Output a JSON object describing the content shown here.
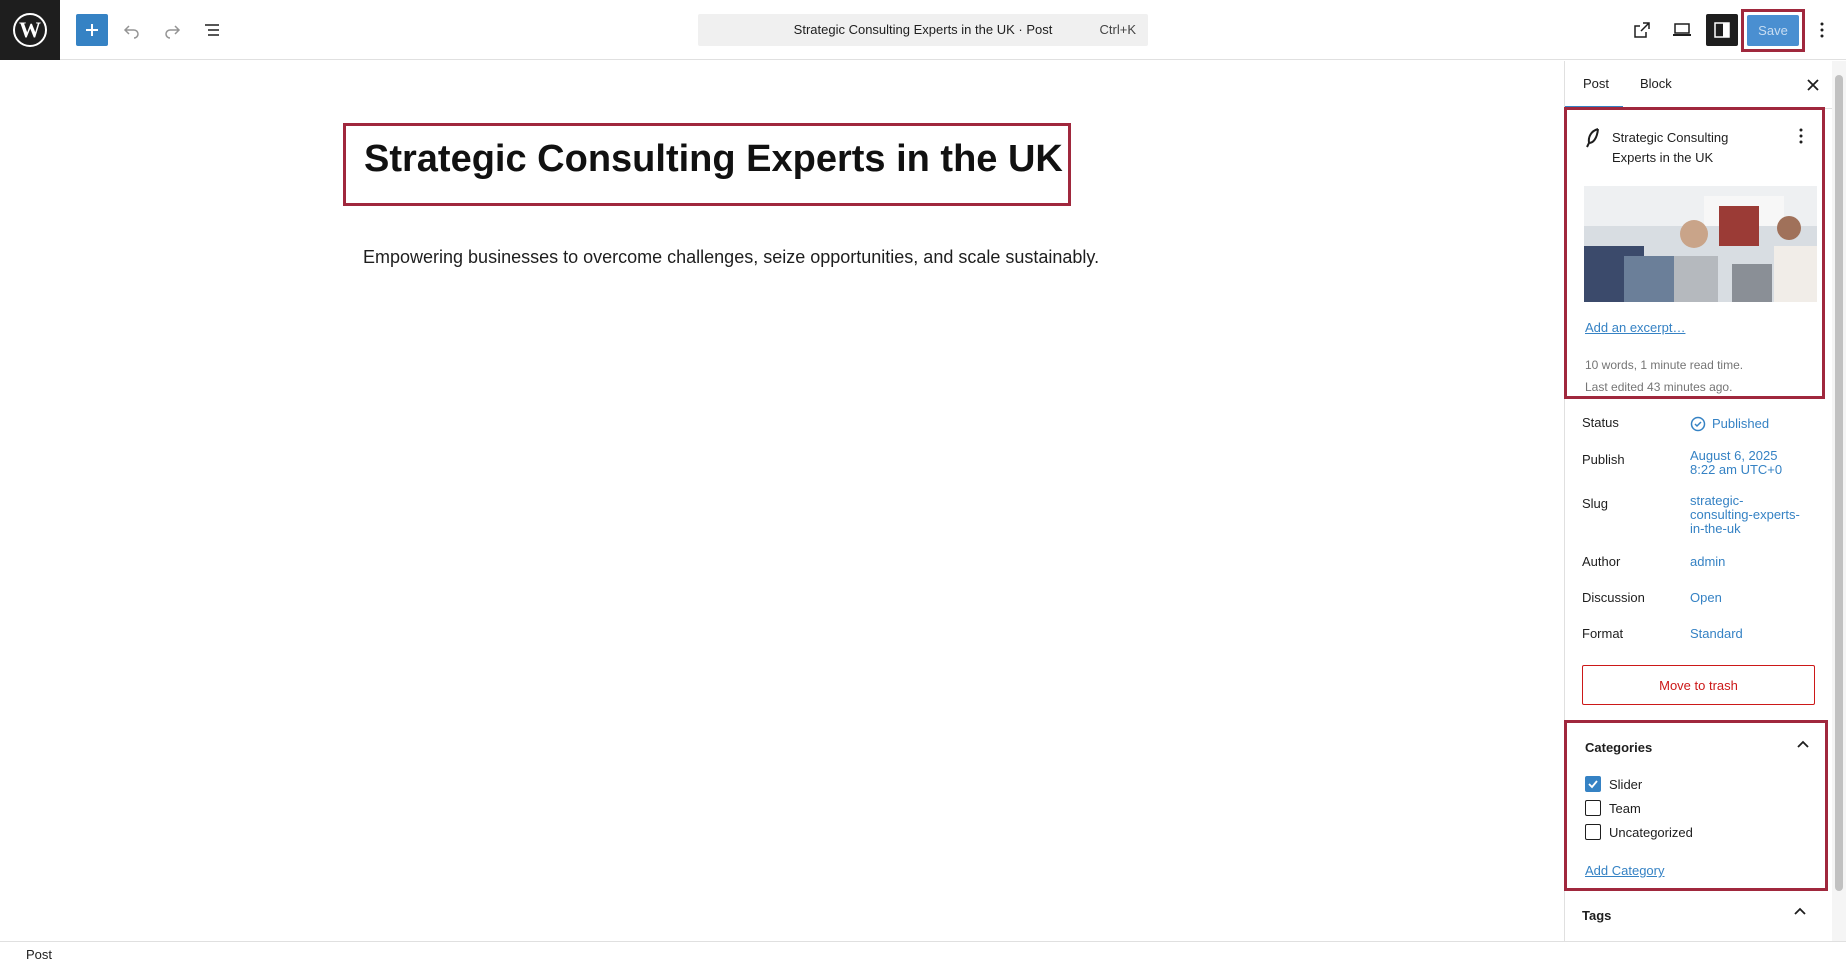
{
  "toolbar": {
    "command_title": "Strategic Consulting Experts in the UK · Post",
    "shortcut": "Ctrl+K",
    "save_label": "Save"
  },
  "editor": {
    "title": "Strategic Consulting Experts in the UK",
    "paragraph": "Empowering businesses to overcome challenges, seize opportunities, and scale sustainably."
  },
  "sidebar": {
    "tabs": [
      "Post",
      "Block"
    ],
    "summary": {
      "title": "Strategic Consulting Experts in the UK",
      "excerpt_link": "Add an excerpt…",
      "word_count": "10 words, 1 minute read time.",
      "last_edited": "Last edited 43 minutes ago."
    },
    "fields": [
      {
        "label": "Status",
        "value": "Published"
      },
      {
        "label": "Publish",
        "value": "August 6, 2025\n8:22 am UTC+0"
      },
      {
        "label": "Slug",
        "value": "strategic-\nconsulting-experts-\nin-the-uk"
      },
      {
        "label": "Author",
        "value": "admin"
      },
      {
        "label": "Discussion",
        "value": "Open"
      },
      {
        "label": "Format",
        "value": "Standard"
      }
    ],
    "trash_label": "Move to trash",
    "categories": {
      "heading": "Categories",
      "items": [
        {
          "label": "Slider",
          "checked": true
        },
        {
          "label": "Team",
          "checked": false
        },
        {
          "label": "Uncategorized",
          "checked": false
        }
      ],
      "add_link": "Add Category"
    },
    "tags_heading": "Tags"
  },
  "footer": {
    "breadcrumb": "Post"
  },
  "colors": {
    "accent": "#3582c4",
    "highlight": "#a0283d",
    "danger": "#cc1818"
  }
}
